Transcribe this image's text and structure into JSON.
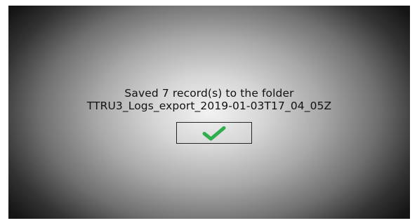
{
  "dialog": {
    "message_line1": "Saved 7 record(s) to the folder",
    "message_line2": "TTRU3_Logs_export_2019-01-03T17_04_05Z"
  },
  "ok_button": {
    "icon": "checkmark-icon",
    "icon_color": "#2fae4e"
  }
}
